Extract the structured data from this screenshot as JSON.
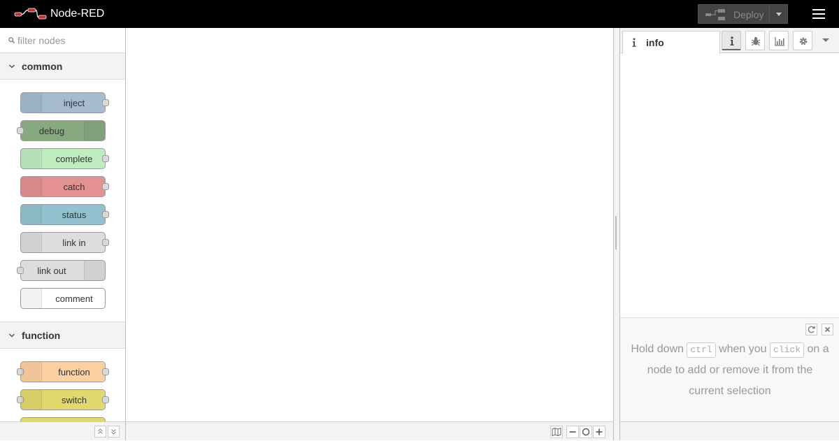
{
  "header": {
    "brand": "Node-RED",
    "deploy_label": "Deploy"
  },
  "palette": {
    "filter_placeholder": "filter nodes",
    "categories": [
      {
        "label": "common",
        "nodes": [
          {
            "label": "inject",
            "color": "#a6bbcf"
          },
          {
            "label": "debug",
            "color": "#87a980"
          },
          {
            "label": "complete",
            "color": "#c0edc0"
          },
          {
            "label": "catch",
            "color": "#e49191"
          },
          {
            "label": "status",
            "color": "#94c1d0"
          },
          {
            "label": "link in",
            "color": "#dddddd"
          },
          {
            "label": "link out",
            "color": "#dddddd"
          },
          {
            "label": "comment",
            "color": "#ffffff"
          }
        ]
      },
      {
        "label": "function",
        "nodes": [
          {
            "label": "function",
            "color": "#fdd0a2"
          },
          {
            "label": "switch",
            "color": "#e2d96e"
          }
        ]
      }
    ]
  },
  "sidebar": {
    "active_tab": "info",
    "tip": {
      "part1": "Hold down",
      "key1": "ctrl",
      "part2": "when you",
      "key2": "click",
      "part3": "on a node to add or remove it from the current selection"
    }
  }
}
